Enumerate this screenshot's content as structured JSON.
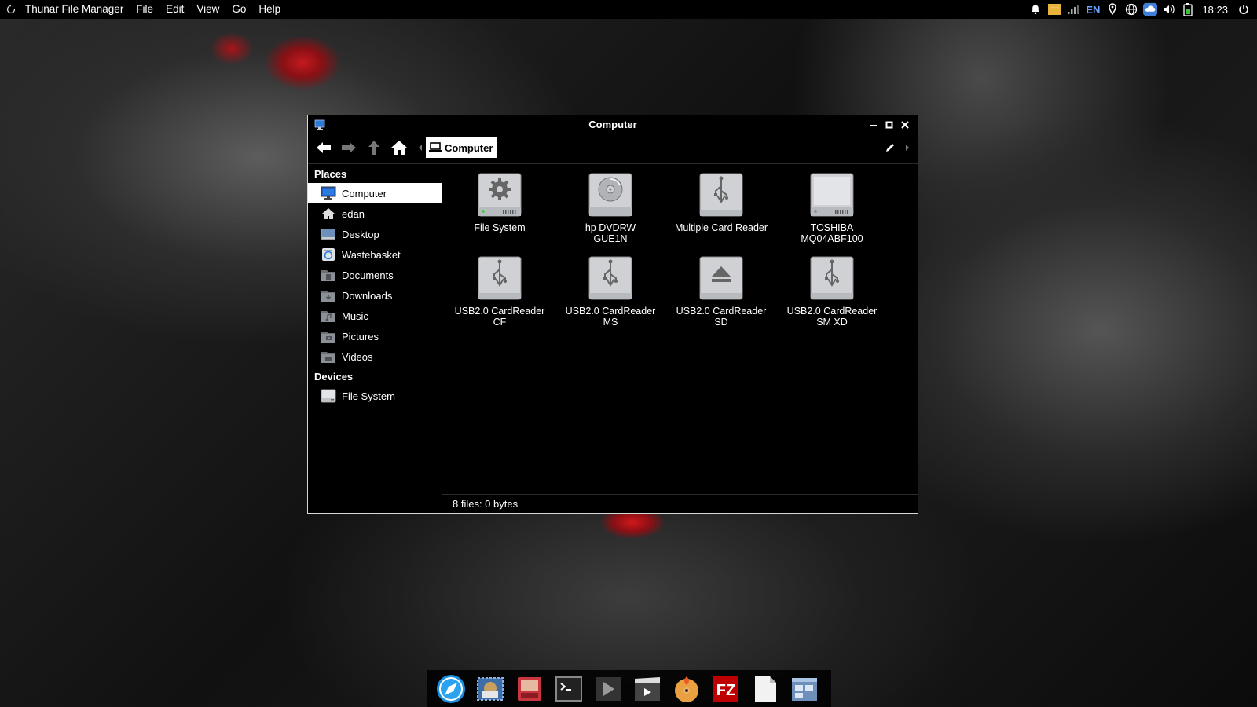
{
  "top_panel": {
    "app_name": "Thunar File Manager",
    "menus": [
      "File",
      "Edit",
      "View",
      "Go",
      "Help"
    ],
    "tray": {
      "language": "EN",
      "clock": "18:23"
    }
  },
  "window": {
    "title": "Computer",
    "path_button": "Computer",
    "sidebar": {
      "places_header": "Places",
      "places": [
        {
          "label": "Computer",
          "icon": "computer-icon",
          "selected": true
        },
        {
          "label": "edan",
          "icon": "home-icon"
        },
        {
          "label": "Desktop",
          "icon": "desktop-icon"
        },
        {
          "label": "Wastebasket",
          "icon": "trash-icon"
        },
        {
          "label": "Documents",
          "icon": "documents-folder-icon"
        },
        {
          "label": "Downloads",
          "icon": "downloads-folder-icon"
        },
        {
          "label": "Music",
          "icon": "music-folder-icon"
        },
        {
          "label": "Pictures",
          "icon": "pictures-folder-icon"
        },
        {
          "label": "Videos",
          "icon": "videos-folder-icon"
        }
      ],
      "devices_header": "Devices",
      "devices": [
        {
          "label": "File System",
          "icon": "drive-icon"
        }
      ]
    },
    "items": [
      {
        "label": "File System",
        "icon": "filesystem-gear-icon"
      },
      {
        "label": "hp       DVDRW\nGUE1N",
        "icon": "optical-drive-icon"
      },
      {
        "label": "Multiple Card  Reader",
        "icon": "usb-drive-icon"
      },
      {
        "label": "TOSHIBA\nMQ04ABF100",
        "icon": "hard-disk-icon"
      },
      {
        "label": "USB2.0 CardReader\nCF",
        "icon": "usb-drive-icon"
      },
      {
        "label": "USB2.0 CardReader\nMS",
        "icon": "usb-drive-icon"
      },
      {
        "label": "USB2.0 CardReader\nSD",
        "icon": "eject-drive-icon"
      },
      {
        "label": "USB2.0 CardReader\nSM XD",
        "icon": "usb-drive-icon"
      }
    ],
    "status": "8 files: 0 bytes"
  },
  "dock": {
    "items": [
      "browser-icon",
      "mail-icon",
      "image-viewer-icon",
      "terminal-icon",
      "media-player-icon",
      "video-editor-icon",
      "disc-burner-icon",
      "filezilla-icon",
      "text-editor-icon",
      "file-manager-icon"
    ]
  },
  "colors": {
    "accent_blue": "#1e5fbf",
    "selected_bg": "#ffffff",
    "window_bg": "#000000"
  }
}
